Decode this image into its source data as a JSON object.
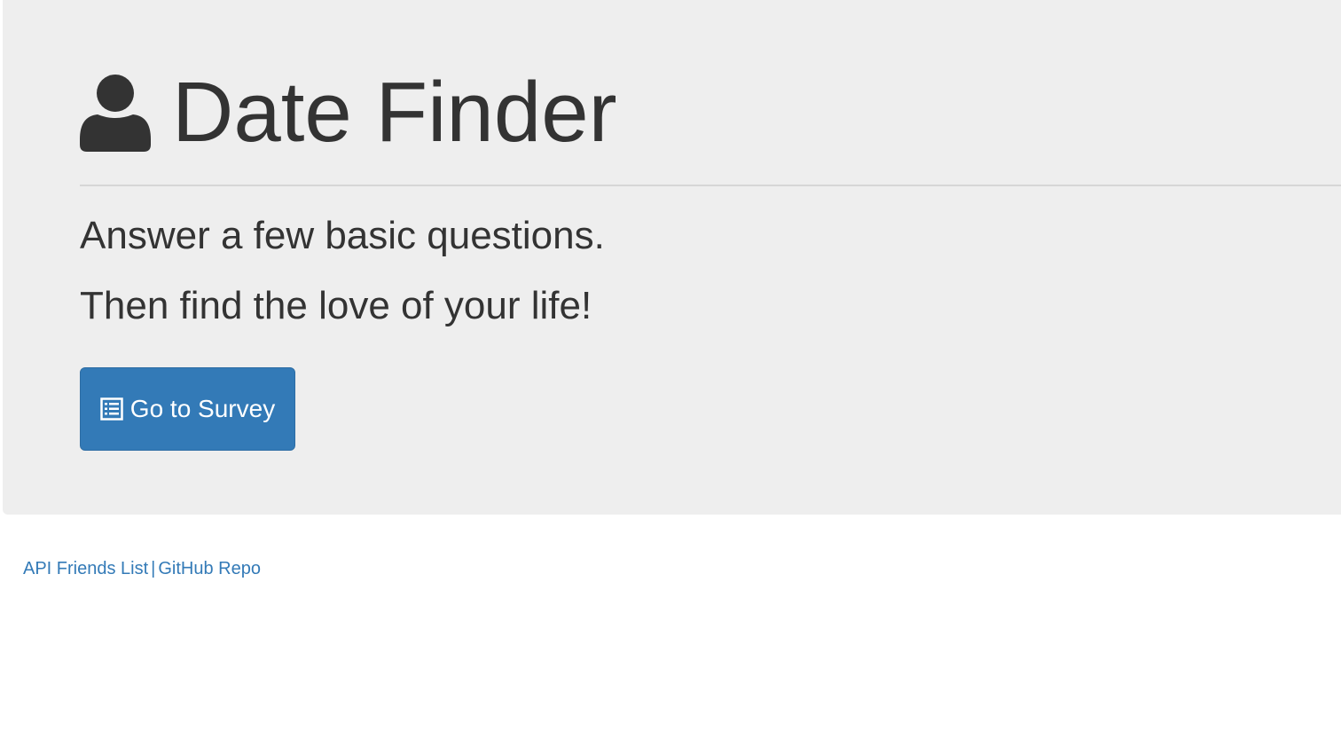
{
  "header": {
    "title": "Date Finder",
    "icon": "user-icon"
  },
  "main": {
    "lead_line_1": "Answer a few basic questions.",
    "lead_line_2": "Then find the love of your life!",
    "survey_button": {
      "label": "Go to Survey",
      "icon": "list-alt-icon"
    }
  },
  "footer": {
    "links": [
      {
        "label": "API Friends List"
      },
      {
        "label": "GitHub Repo"
      }
    ],
    "separator": "|"
  },
  "colors": {
    "jumbotron_bg": "#eeeeee",
    "text": "#333333",
    "primary": "#337ab7",
    "link": "#337ab7"
  }
}
